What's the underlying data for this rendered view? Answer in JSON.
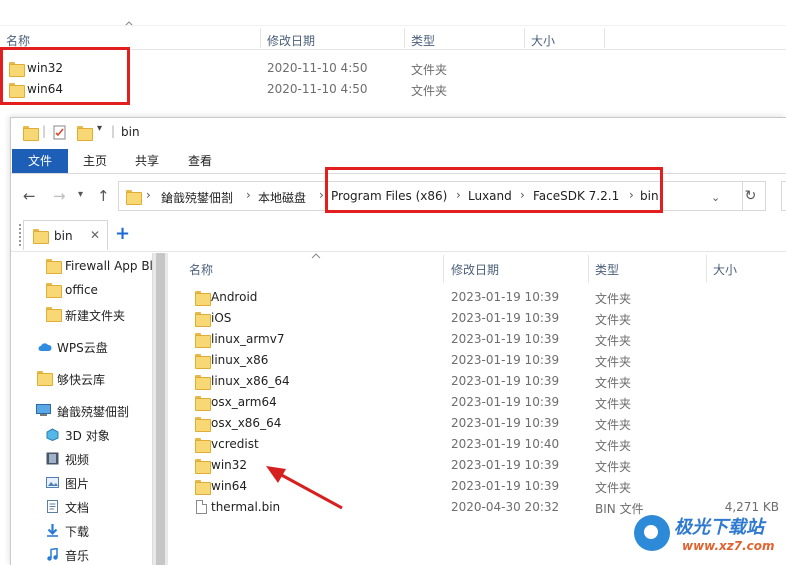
{
  "background_window": {
    "columns": {
      "name": "名称",
      "date": "修改日期",
      "type": "类型",
      "size": "大小"
    },
    "rows": [
      {
        "name": "win32",
        "date": "2020-11-10 4:50",
        "type": "文件夹"
      },
      {
        "name": "win64",
        "date": "2020-11-10 4:50",
        "type": "文件夹"
      }
    ]
  },
  "window": {
    "title": "bin",
    "ribbon_tabs": [
      "文件",
      "主页",
      "共享",
      "查看"
    ],
    "breadcrumb": [
      "鎗戠殑鐢佃剳",
      "本地磁盘",
      "Program Files (x86)",
      "Luxand",
      "FaceSDK 7.2.1",
      "bin"
    ],
    "tab": {
      "label": "bin"
    }
  },
  "sidebar": {
    "items": [
      {
        "label": "Firewall App Bl",
        "icon": "folder-icon"
      },
      {
        "label": "office",
        "icon": "folder-icon"
      },
      {
        "label": "新建文件夹",
        "icon": "folder-icon"
      },
      {
        "label": "WPS云盘",
        "icon": "cloud-icon"
      },
      {
        "label": "够快云库",
        "icon": "folder-icon"
      },
      {
        "label": "鎗戠殑鐢佃剳",
        "icon": "computer-icon"
      },
      {
        "label": "3D 对象",
        "icon": "3d-objects-icon"
      },
      {
        "label": "视频",
        "icon": "video-icon"
      },
      {
        "label": "图片",
        "icon": "pictures-icon"
      },
      {
        "label": "文档",
        "icon": "documents-icon"
      },
      {
        "label": "下载",
        "icon": "download-icon"
      },
      {
        "label": "音乐",
        "icon": "music-icon"
      }
    ]
  },
  "file_list": {
    "columns": {
      "name": "名称",
      "date": "修改日期",
      "type": "类型",
      "size": "大小"
    },
    "rows": [
      {
        "name": "Android",
        "date": "2023-01-19 10:39",
        "type": "文件夹",
        "size": ""
      },
      {
        "name": "iOS",
        "date": "2023-01-19 10:39",
        "type": "文件夹",
        "size": ""
      },
      {
        "name": "linux_armv7",
        "date": "2023-01-19 10:39",
        "type": "文件夹",
        "size": ""
      },
      {
        "name": "linux_x86",
        "date": "2023-01-19 10:39",
        "type": "文件夹",
        "size": ""
      },
      {
        "name": "linux_x86_64",
        "date": "2023-01-19 10:39",
        "type": "文件夹",
        "size": ""
      },
      {
        "name": "osx_arm64",
        "date": "2023-01-19 10:39",
        "type": "文件夹",
        "size": ""
      },
      {
        "name": "osx_x86_64",
        "date": "2023-01-19 10:39",
        "type": "文件夹",
        "size": ""
      },
      {
        "name": "vcredist",
        "date": "2023-01-19 10:40",
        "type": "文件夹",
        "size": ""
      },
      {
        "name": "win32",
        "date": "2023-01-19 10:39",
        "type": "文件夹",
        "size": ""
      },
      {
        "name": "win64",
        "date": "2023-01-19 10:39",
        "type": "文件夹",
        "size": ""
      },
      {
        "name": "thermal.bin",
        "date": "2020-04-30 20:32",
        "type": "BIN 文件",
        "size": "4,271 KB"
      }
    ]
  },
  "watermark": {
    "title": "极光下载站",
    "url": "www.xz7.com"
  },
  "colors": {
    "highlight_box": "#e21e1e",
    "arrow": "#d62020",
    "ribbon_file_tab": "#1d5fb7",
    "folder": "#f8d775"
  }
}
